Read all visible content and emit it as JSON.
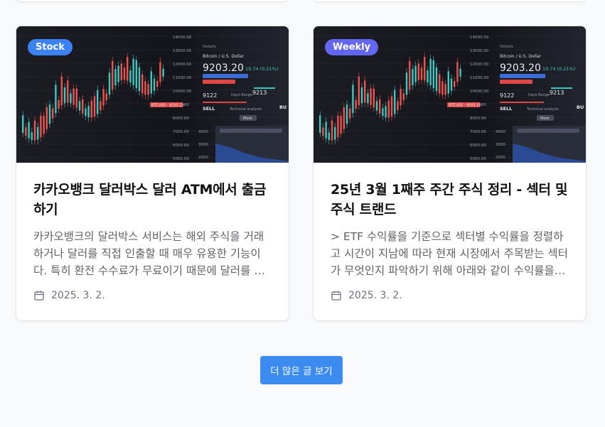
{
  "cards": [
    {
      "badge": "Stock",
      "title": "카카오뱅크 달러박스 달러 ATM에서 출금하기",
      "excerpt": "카카오뱅크의 달러박스 서비스는 해외 주식을 거래하거나 달러를 직접 인출할 때 매우 유용한 기능이다. 특히 환전 수수료가 무료이기 때문에 달러를 환전할 때...",
      "date": "2025. 3. 2.",
      "accent": "#3b82f6"
    },
    {
      "badge": "Weekly",
      "title": "25년 3월 1째주 주간 주식 정리 - 섹터 및 주식 트랜드",
      "excerpt": "> ETF 수익률을 기준으로 섹터별 수익률을 정렬하고 시간이 지남에 따라 현재 시장에서 주목받는 섹터가 무엇인지 파악하기 위해 아래와 같이 수익률을 정리해...",
      "date": "2025. 3. 2.",
      "accent": "#6366f1"
    }
  ],
  "thumbnail": {
    "pair": "Bitcoin / U.S. Dollar",
    "price": "9203.20",
    "change": "19.74 (0.21%)",
    "sell_label": "SELL",
    "buy_label": "BU",
    "sell_price": "9122",
    "buy_price": "9213",
    "ticker_tag": "BTCUSD · 9203.20",
    "details": "Details",
    "days_range": "Days Range",
    "tech": "Technical analysis",
    "more": "More",
    "y_ticks": [
      "14000.00",
      "13000.00",
      "12000.00",
      "11000.00",
      "10000.00",
      "9000.00",
      "8000.00",
      "7000.00",
      "6000.00",
      "5000.00"
    ],
    "right_ticks": [
      "4000",
      "3000",
      "2000"
    ]
  },
  "load_more_label": "더 많은 글 보기",
  "icons": {
    "date": "calendar-icon"
  }
}
